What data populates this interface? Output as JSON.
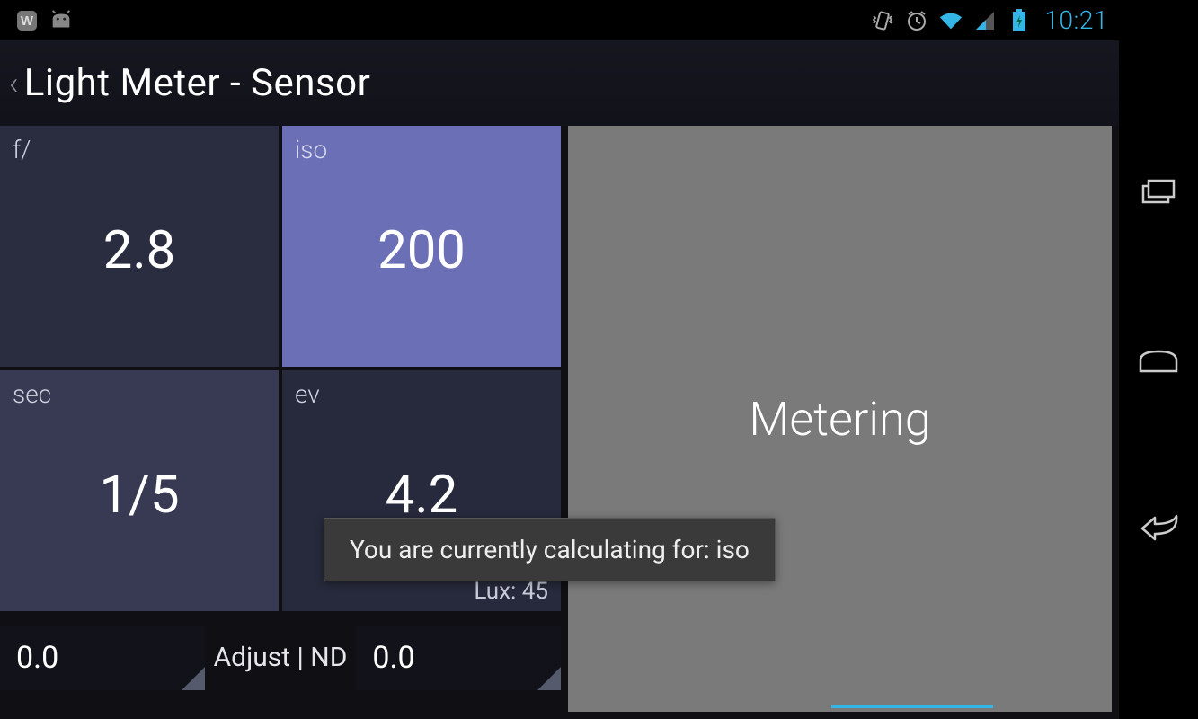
{
  "status": {
    "time": "10:21"
  },
  "header": {
    "title": "Light Meter - Sensor"
  },
  "tiles": {
    "f": {
      "label": "f/",
      "value": "2.8"
    },
    "iso": {
      "label": "iso",
      "value": "200"
    },
    "sec": {
      "label": "sec",
      "value": "1/5"
    },
    "ev": {
      "label": "ev",
      "value": "4.2",
      "lux_label": "Lux: 45"
    }
  },
  "bottom": {
    "adjust_left": "0.0",
    "adjust_label": "Adjust | ND",
    "adjust_right": "0.0"
  },
  "meter": {
    "label": "Metering"
  },
  "toast": {
    "text": "You are currently calculating for: iso"
  }
}
